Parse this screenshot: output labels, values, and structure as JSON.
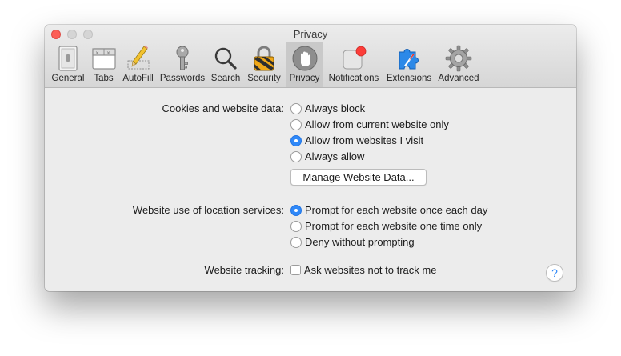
{
  "window": {
    "title": "Privacy"
  },
  "toolbar": {
    "tabs": [
      {
        "label": "General",
        "icon": "general-icon",
        "selected": false
      },
      {
        "label": "Tabs",
        "icon": "tabs-icon",
        "selected": false
      },
      {
        "label": "AutoFill",
        "icon": "autofill-icon",
        "selected": false
      },
      {
        "label": "Passwords",
        "icon": "key-icon",
        "selected": false
      },
      {
        "label": "Search",
        "icon": "search-icon",
        "selected": false
      },
      {
        "label": "Security",
        "icon": "lock-icon",
        "selected": false
      },
      {
        "label": "Privacy",
        "icon": "hand-icon",
        "selected": true
      },
      {
        "label": "Notifications",
        "icon": "notifications-icon",
        "selected": false
      },
      {
        "label": "Extensions",
        "icon": "puzzle-icon",
        "selected": false
      },
      {
        "label": "Advanced",
        "icon": "gear-icon",
        "selected": false
      }
    ]
  },
  "cookies": {
    "label": "Cookies and website data:",
    "options": [
      {
        "label": "Always block",
        "selected": false
      },
      {
        "label": "Allow from current website only",
        "selected": false
      },
      {
        "label": "Allow from websites I visit",
        "selected": true
      },
      {
        "label": "Always allow",
        "selected": false
      }
    ],
    "manage_button": "Manage Website Data..."
  },
  "location": {
    "label": "Website use of location services:",
    "options": [
      {
        "label": "Prompt for each website once each day",
        "selected": true
      },
      {
        "label": "Prompt for each website one time only",
        "selected": false
      },
      {
        "label": "Deny without prompting",
        "selected": false
      }
    ]
  },
  "tracking": {
    "label": "Website tracking:",
    "checkbox_label": "Ask websites not to track me",
    "checked": false
  },
  "help": {
    "label": "?"
  },
  "colors": {
    "accent": "#2f88f8",
    "close_button": "#fc5f57",
    "notification_badge": "#fc3d39"
  }
}
